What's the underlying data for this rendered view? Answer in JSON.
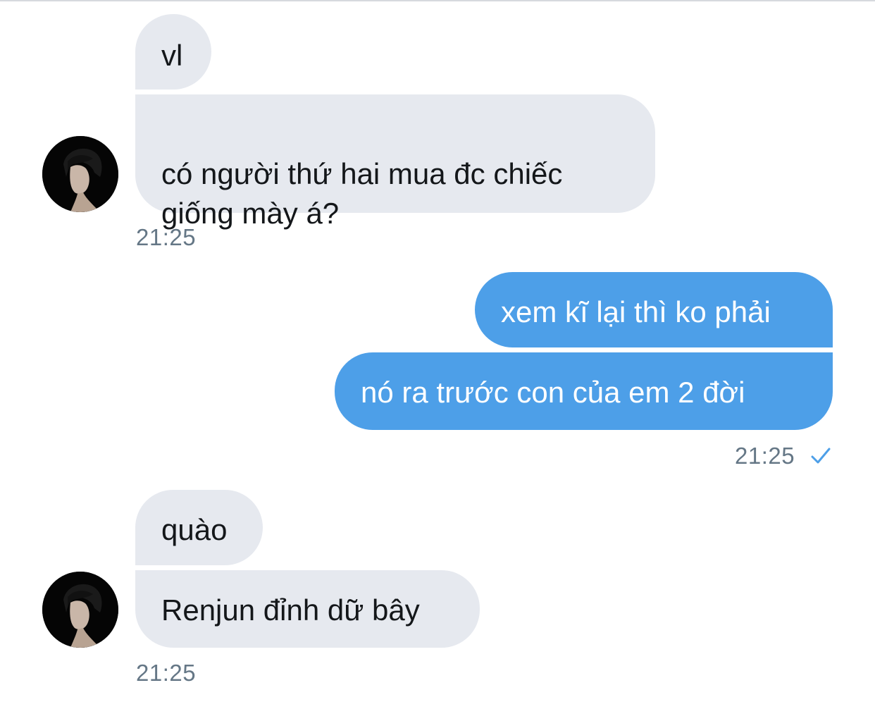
{
  "conversation": {
    "groups": [
      {
        "side": "incoming",
        "messages": [
          "vl",
          "có người thứ hai mua đc chiếc\ngiống mày á?"
        ],
        "time": "21:25",
        "avatar_icon": "user-avatar"
      },
      {
        "side": "outgoing",
        "messages": [
          "xem kĩ lại thì ko phải",
          "nó ra trước con của em 2 đời"
        ],
        "time": "21:25",
        "status_icon": "checkmark-icon"
      },
      {
        "side": "incoming",
        "messages": [
          "quào",
          "Renjun đỉnh dữ bây"
        ],
        "time": "21:25",
        "avatar_icon": "user-avatar"
      }
    ]
  },
  "colors": {
    "incoming_bubble": "#e6e9ef",
    "outgoing_bubble": "#4d9fe8",
    "timestamp": "#657786",
    "check": "#4d9fe8"
  }
}
